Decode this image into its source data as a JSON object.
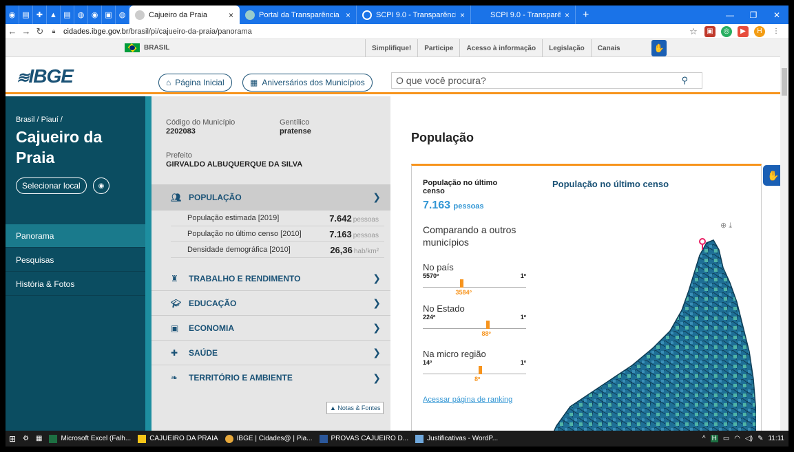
{
  "browser": {
    "tabs": [
      {
        "label": "Cajueiro da Praia",
        "active": true
      },
      {
        "label": "Portal da Transparência -",
        "active": false
      },
      {
        "label": "SCPI 9.0 - Transparência",
        "active": false
      },
      {
        "label": "SCPI 9.0 - Transparência",
        "active": false
      }
    ],
    "url_prefix": "cidades.ibge.gov.br",
    "url_path": "/brasil/pi/cajueiro-da-praia/panorama",
    "profile_initial": "H"
  },
  "govbar": {
    "brasil": "BRASIL",
    "links": [
      "Simplifique!",
      "Participe",
      "Acesso à informação",
      "Legislação",
      "Canais"
    ]
  },
  "header": {
    "logo": "IBGE",
    "home_label": "Página Inicial",
    "anniversary_label": "Aniversários dos Municípios",
    "search_placeholder": "O que você procura?"
  },
  "sidebar": {
    "breadcrumb": "Brasil / Piauí /",
    "city": "Cajueiro da Praia",
    "select_label": "Selecionar local",
    "nav": [
      "Panorama",
      "Pesquisas",
      "História & Fotos"
    ]
  },
  "info": {
    "code_label": "Código do Município",
    "code_value": "2202083",
    "gentilico_label": "Gentílico",
    "gentilico_value": "pratense",
    "prefeito_label": "Prefeito",
    "prefeito_value": "GIRVALDO ALBUQUERQUE DA SILVA",
    "categories": [
      "POPULAÇÃO",
      "TRABALHO E RENDIMENTO",
      "EDUCAÇÃO",
      "ECONOMIA",
      "SAÚDE",
      "TERRITÓRIO E AMBIENTE"
    ],
    "rows": [
      {
        "label": "População estimada [2019]",
        "value": "7.642",
        "unit": "pessoas"
      },
      {
        "label": "População no último censo [2010]",
        "value": "7.163",
        "unit": "pessoas"
      },
      {
        "label": "Densidade demográfica [2010]",
        "value": "26,36",
        "unit": "hab/km²"
      }
    ],
    "notes_label": "Notas & Fontes"
  },
  "main": {
    "section_title": "População",
    "card_title": "População no último censo",
    "card_value": "7.163",
    "card_unit": "pessoas",
    "compare_label": "Comparando a outros municípios",
    "rankings": [
      {
        "label": "No país",
        "min": "5570º",
        "max": "1º",
        "value": "3584º",
        "fraction": 0.357
      },
      {
        "label": "No Estado",
        "min": "224º",
        "max": "1º",
        "value": "88º",
        "fraction": 0.61
      },
      {
        "label": "Na micro região",
        "min": "14º",
        "max": "1º",
        "value": "8º",
        "fraction": 0.54
      }
    ],
    "ranking_link": "Acessar página de ranking",
    "map_title": "População no último censo"
  },
  "taskbar": {
    "items": [
      "Microsoft Excel (Falh...",
      "CAJUEIRO DA PRAIA",
      "IBGE | Cidades@ | Pia...",
      "PROVAS CAJUEIRO D...",
      "Justificativas - WordP..."
    ],
    "time": "11:11"
  },
  "colors": {
    "accent": "#f7941d",
    "sidebar": "#0b4d61",
    "link": "#3296d4",
    "brand": "#1a5276"
  }
}
